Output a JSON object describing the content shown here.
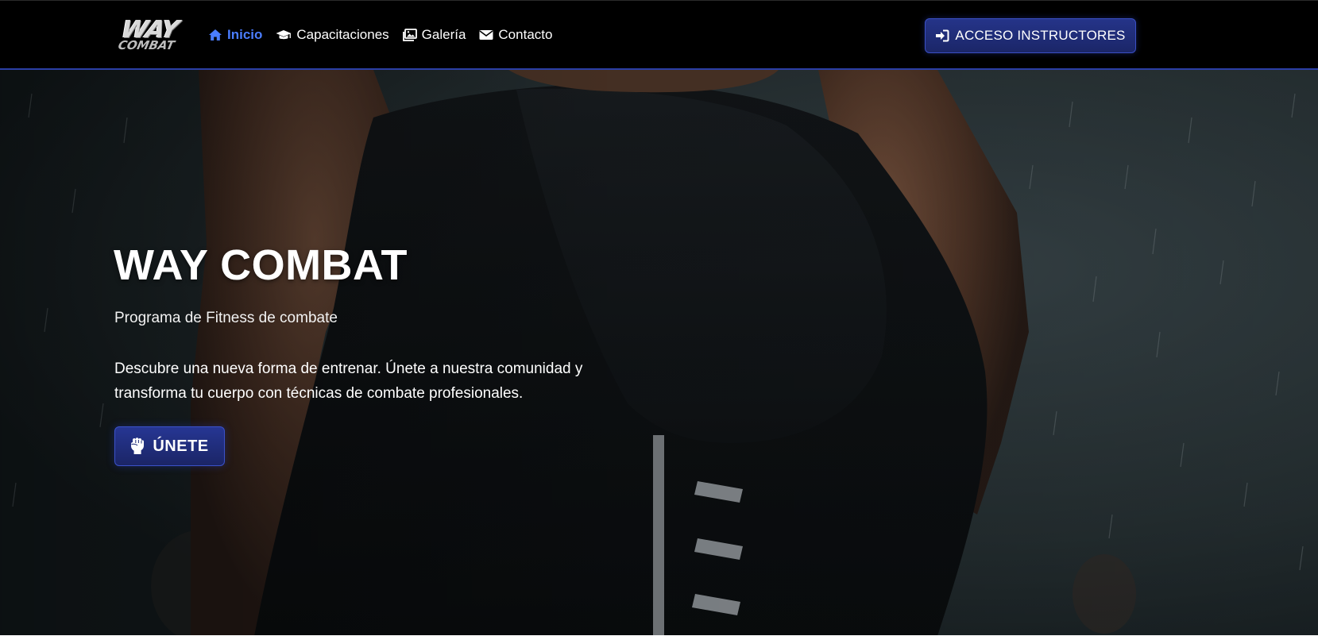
{
  "brand": {
    "logo_line1": "WAY",
    "logo_line2": "COMBAT"
  },
  "nav": {
    "items": [
      {
        "label": "Inicio",
        "icon": "home-icon",
        "active": true
      },
      {
        "label": "Capacitaciones",
        "icon": "graduation-cap-icon",
        "active": false
      },
      {
        "label": "Galería",
        "icon": "images-icon",
        "active": false
      },
      {
        "label": "Contacto",
        "icon": "envelope-icon",
        "active": false
      }
    ],
    "instructor_button": {
      "label": "ACCESO INSTRUCTORES",
      "icon": "sign-in-icon"
    }
  },
  "hero": {
    "title": "WAY COMBAT",
    "subtitle": "Programa de Fitness de combate",
    "description": "Descubre una nueva forma de entrenar. Únete a nuestra comunidad y transforma tu cuerpo con técnicas de combate profesionales.",
    "cta": {
      "label": "ÚNETE",
      "icon": "fist-icon"
    }
  },
  "colors": {
    "navbar_bg": "#000000",
    "accent_blue": "#4a7dff",
    "button_blue": "#1f2d7a",
    "nav_border": "#2b3fa6"
  }
}
